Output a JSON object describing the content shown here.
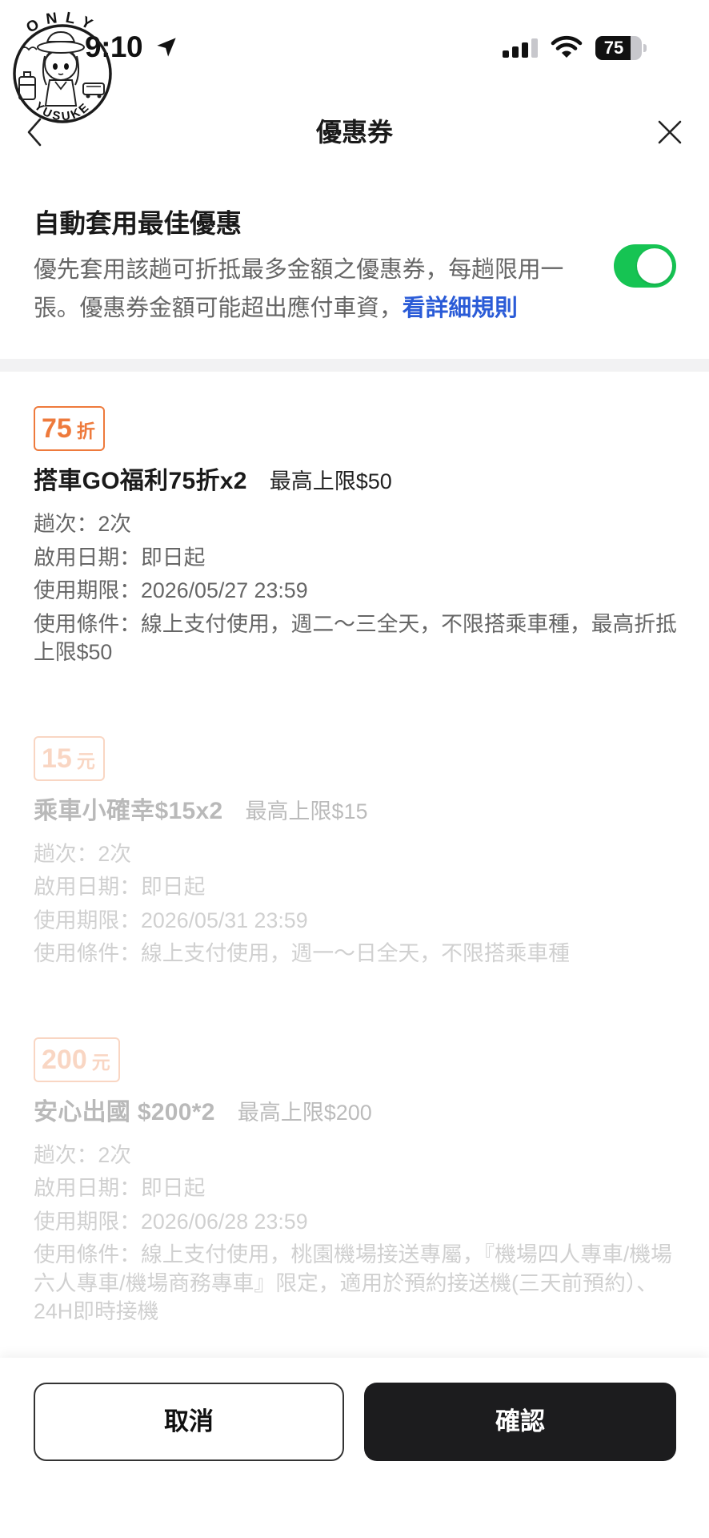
{
  "status_bar": {
    "time": "9:10",
    "location_icon": "location-arrow-icon",
    "signal_bars": 3,
    "signal_bars_max": 4,
    "battery_percent": "75"
  },
  "watermark": {
    "top_text": "ONLY",
    "bottom_text": "YUSUKE"
  },
  "header": {
    "title": "優惠券",
    "back_icon": "chevron-left-icon",
    "close_icon": "close-icon"
  },
  "auto_apply": {
    "title": "自動套用最佳優惠",
    "description": "優先套用該趟可折抵最多金額之優惠券，每趟限用一張。優惠券金額可能超出應付車資，",
    "rules_link": "看詳細規則",
    "enabled": true
  },
  "coupons": [
    {
      "badge_value": "75",
      "badge_unit": "折",
      "name": "搭車GO福利75折x2",
      "limit": "最高上限$50",
      "trips": "趟次：2次",
      "start_date": "啟用日期：即日起",
      "expiry": "使用期限：2026/05/27 23:59",
      "conditions": "使用條件：線上支付使用，週二～三全天，不限搭乘車種，最高折抵上限$50",
      "active": true
    },
    {
      "badge_value": "15",
      "badge_unit": "元",
      "name": "乘車小確幸$15x2",
      "limit": "最高上限$15",
      "trips": "趟次：2次",
      "start_date": "啟用日期：即日起",
      "expiry": "使用期限：2026/05/31 23:59",
      "conditions": "使用條件：線上支付使用，週一～日全天，不限搭乘車種",
      "active": false
    },
    {
      "badge_value": "200",
      "badge_unit": "元",
      "name": "安心出國 $200*2",
      "limit": "最高上限$200",
      "trips": "趟次：2次",
      "start_date": "啟用日期：即日起",
      "expiry": "使用期限：2026/06/28 23:59",
      "conditions": "使用條件：線上支付使用，桃園機場接送專屬，『機場四人專車/機場六人專車/機場商務專車』限定，適用於預約接送機(三天前預約）、24H即時接機",
      "active": false
    }
  ],
  "footer": {
    "cancel_label": "取消",
    "confirm_label": "確認"
  },
  "colors": {
    "accent_orange": "#EE7A3C",
    "toggle_on": "#16C453",
    "link_blue": "#2A5BD7",
    "confirm_button": "#1C1C1E"
  }
}
